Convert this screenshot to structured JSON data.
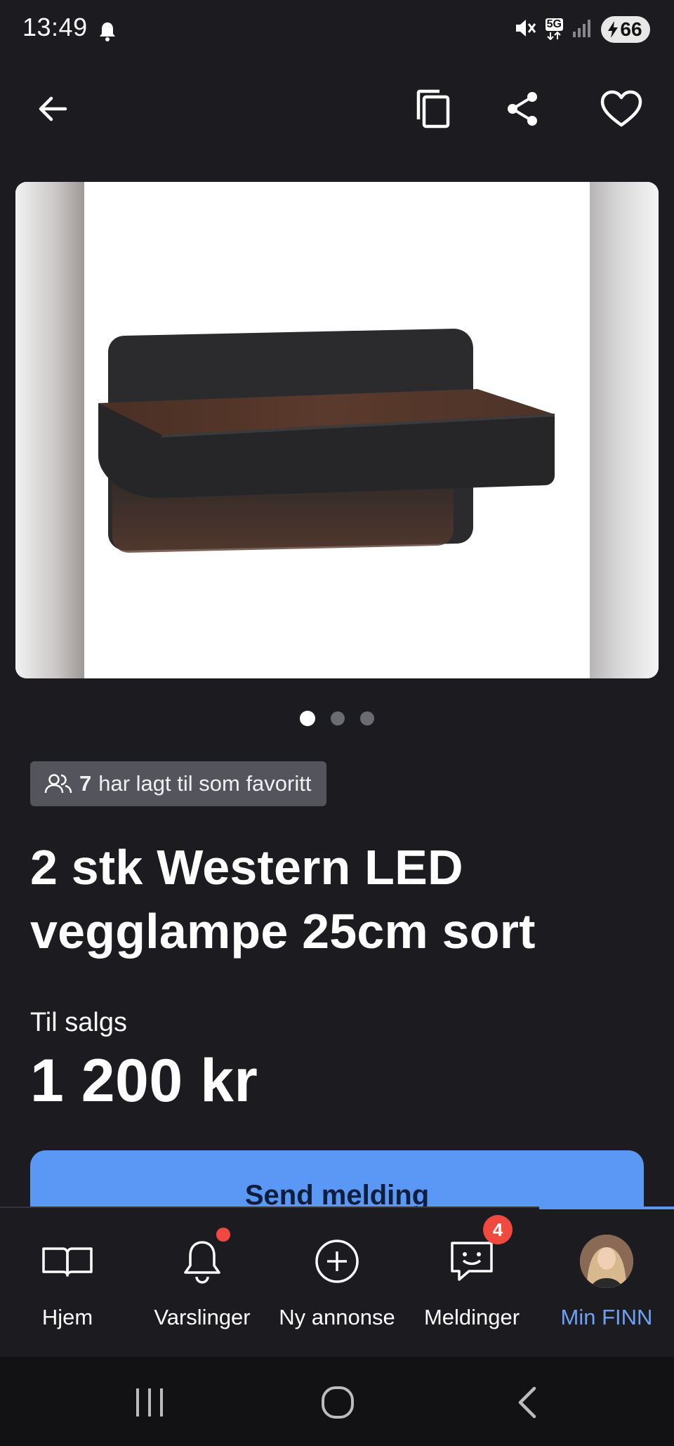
{
  "status": {
    "time": "13:49",
    "network": "5G",
    "battery": "66"
  },
  "listing": {
    "image_index": 1,
    "image_count": 3,
    "favorites_count": "7",
    "favorites_text": "har lagt til som favoritt",
    "title": "2 stk Western LED vegglampe 25cm sort",
    "sale_label": "Til salgs",
    "price": "1 200 kr",
    "send_button": "Send melding"
  },
  "nav": {
    "items": [
      {
        "label": "Hjem",
        "icon": "book-icon",
        "active": false
      },
      {
        "label": "Varslinger",
        "icon": "bell-icon",
        "active": false
      },
      {
        "label": "Ny annonse",
        "icon": "plus-circle-icon",
        "active": false
      },
      {
        "label": "Meldinger",
        "icon": "chat-smile-icon",
        "active": false,
        "badge": "4"
      },
      {
        "label": "Min FINN",
        "icon": "avatar",
        "active": true
      }
    ]
  },
  "colors": {
    "background": "#1b1b20",
    "accent": "#5b97f5",
    "badge": "#f0493f"
  }
}
